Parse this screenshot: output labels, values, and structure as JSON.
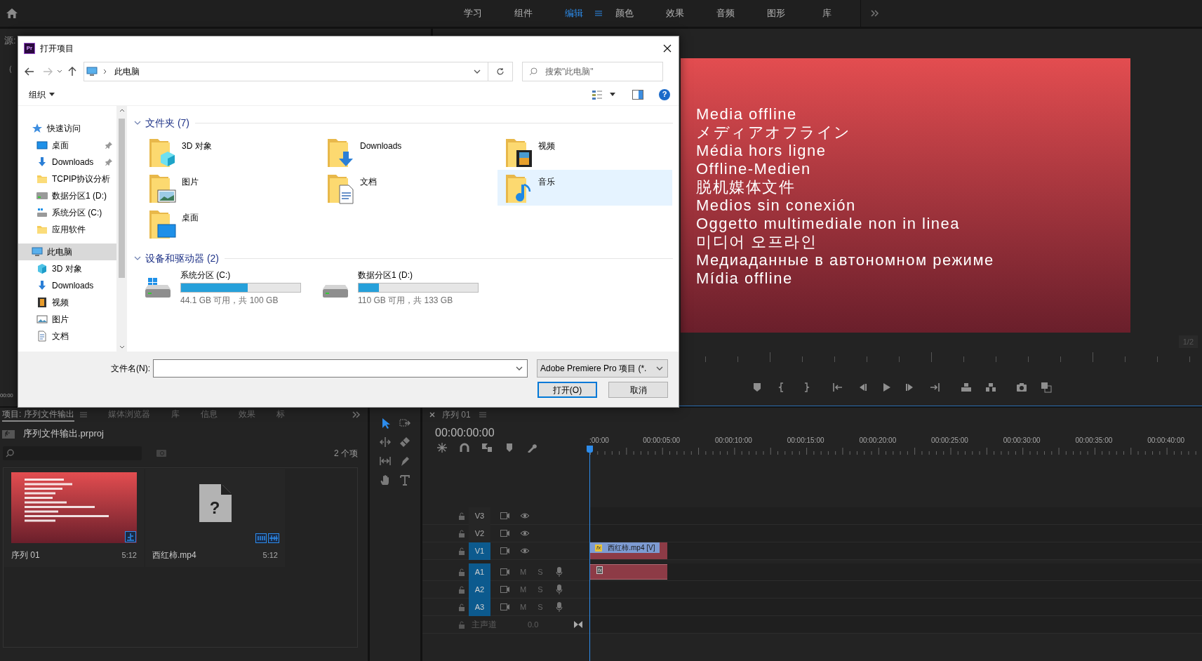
{
  "top_bar": {
    "workspaces": [
      {
        "label": "学习",
        "selected": false
      },
      {
        "label": "组件",
        "selected": false
      },
      {
        "label": "编辑",
        "selected": true
      },
      {
        "label": "颜色",
        "selected": false
      },
      {
        "label": "效果",
        "selected": false
      },
      {
        "label": "音频",
        "selected": false
      },
      {
        "label": "图形",
        "selected": false
      },
      {
        "label": "库",
        "selected": false
      }
    ]
  },
  "source_panel": {
    "tab": "源:",
    "status": "（",
    "timecode": "00:00"
  },
  "program_monitor": {
    "frame_lines": [
      "Media offline",
      "メディアオフライン",
      "Média hors ligne",
      "Offline-Medien",
      "脱机媒体文件",
      "Medios sin conexión",
      "Oggetto multimediale non in linea",
      "미디어 오프라인",
      "Медиаданные в автономном режиме",
      "Mídia offline"
    ],
    "page": "1/2"
  },
  "dialog": {
    "app_badge": "Pr",
    "title": "打开项目",
    "address": "此电脑",
    "search": {
      "placeholder": "搜索\"此电脑\""
    },
    "organize": "组织",
    "help": "?",
    "nav": [
      {
        "label": "快速访问",
        "kind": "star",
        "selected": false,
        "children": [
          {
            "label": "桌面",
            "kind": "desktop",
            "selected": false,
            "pinned": true
          },
          {
            "label": "Downloads",
            "kind": "download",
            "selected": false,
            "pinned": true
          },
          {
            "label": "TCPIP协议分析",
            "kind": "folder",
            "selected": false,
            "pinned": false
          },
          {
            "label": "数据分区1 (D:)",
            "kind": "drive",
            "selected": false,
            "pinned": false
          },
          {
            "label": "系统分区 (C:)",
            "kind": "windows-drive",
            "selected": false,
            "pinned": false
          },
          {
            "label": "应用软件",
            "kind": "folder",
            "selected": false,
            "pinned": false
          }
        ]
      },
      {
        "label": "此电脑",
        "kind": "pc",
        "selected": true,
        "children": [
          {
            "label": "3D 对象",
            "kind": "cube",
            "selected": false
          },
          {
            "label": "Downloads",
            "kind": "download",
            "selected": false
          },
          {
            "label": "视频",
            "kind": "video",
            "selected": false
          },
          {
            "label": "图片",
            "kind": "picture",
            "selected": false
          },
          {
            "label": "文档",
            "kind": "document",
            "selected": false
          }
        ]
      }
    ],
    "folders_header": "文件夹 (7)",
    "folders": [
      {
        "label": "3D 对象",
        "kind": "cube",
        "selected": false
      },
      {
        "label": "Downloads",
        "kind": "download",
        "selected": false
      },
      {
        "label": "视频",
        "kind": "video",
        "selected": false
      },
      {
        "label": "图片",
        "kind": "picture",
        "selected": false
      },
      {
        "label": "文档",
        "kind": "document",
        "selected": false
      },
      {
        "label": "音乐",
        "kind": "music",
        "selected": true
      },
      {
        "label": "桌面",
        "kind": "desktop",
        "selected": false
      }
    ],
    "drives_header": "设备和驱动器 (2)",
    "drives": [
      {
        "label": "系统分区 (C:)",
        "kind": "windows-drive",
        "level": 0.56,
        "free": "44.1 GB 可用，共 100 GB"
      },
      {
        "label": "数据分区1 (D:)",
        "kind": "drive",
        "level": 0.17,
        "free": "110 GB 可用，共 133 GB"
      }
    ],
    "filename_label": "文件名(N):",
    "filetype": "Adobe Premiere Pro 项目 (*.",
    "buttons": [
      {
        "label": "打开(O)",
        "default": true
      },
      {
        "label": "取消",
        "default": false
      }
    ]
  },
  "project_panel": {
    "tabs": [
      {
        "label": "项目: 序列文件输出",
        "selected": true
      },
      {
        "label": "媒体浏览器",
        "selected": false
      },
      {
        "label": "库",
        "selected": false
      },
      {
        "label": "信息",
        "selected": false
      },
      {
        "label": "效果",
        "selected": false
      },
      {
        "label": "标",
        "selected": false
      }
    ],
    "project_file": "序列文件输出.prproj",
    "item_count": "2 个项",
    "items": [
      {
        "name": "序列 01",
        "duration": "5:12",
        "kind": "sequence"
      },
      {
        "name": "西红柿.mp4",
        "duration": "5:12",
        "kind": "offline",
        "glyph": "?"
      }
    ]
  },
  "timeline": {
    "sequence_tab": "序列 01",
    "timecode": "00:00:00:00",
    "ruler": [
      ":00:00",
      "00:00:05:00",
      "00:00:10:00",
      "00:00:15:00",
      "00:00:20:00",
      "00:00:25:00",
      "00:00:30:00",
      "00:00:35:00",
      "00:00:40:00"
    ],
    "tracks": [
      {
        "label": "V3",
        "kind": "video",
        "targeted": false
      },
      {
        "label": "V2",
        "kind": "video",
        "targeted": false
      },
      {
        "label": "V1",
        "kind": "video",
        "targeted": true,
        "clip": {
          "label": "西红柿.mp4 [V]",
          "badge": "fx"
        }
      },
      {
        "label": "A1",
        "kind": "audio",
        "targeted": true,
        "mute": "M",
        "solo": "S",
        "clip": {
          "badge": "fx"
        }
      },
      {
        "label": "A2",
        "kind": "audio",
        "targeted": true,
        "mute": "M",
        "solo": "S"
      },
      {
        "label": "A3",
        "kind": "audio",
        "targeted": true,
        "mute": "M",
        "solo": "S"
      }
    ],
    "master": {
      "label": "主声道",
      "value": "0.0"
    }
  }
}
